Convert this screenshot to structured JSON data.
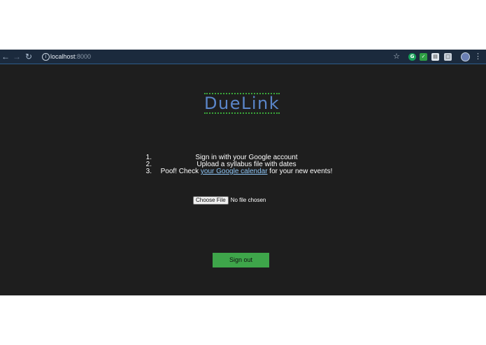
{
  "browser": {
    "url_host": "localhost",
    "url_port": ":8000",
    "back_icon": "arrow-left-icon",
    "forward_icon": "arrow-right-icon",
    "reload_icon": "reload-icon",
    "colors": {
      "toolbar": "#1b2a3d",
      "page_bg": "#1e1e1e"
    }
  },
  "app": {
    "logo": "DueLink",
    "logo_color": "#5b86c9",
    "steps": [
      {
        "num": "1.",
        "text": "Sign in with your Google account"
      },
      {
        "num": "2.",
        "text": "Upload a syllabus file with dates"
      },
      {
        "num": "3.",
        "pre": "Poof! Check ",
        "link": "your Google calendar",
        "post": " for your new events!"
      }
    ],
    "file_input": {
      "button_label": "Choose File",
      "status": "No file chosen"
    },
    "signout_label": "Sign out",
    "signout_color": "#3ea54a"
  }
}
